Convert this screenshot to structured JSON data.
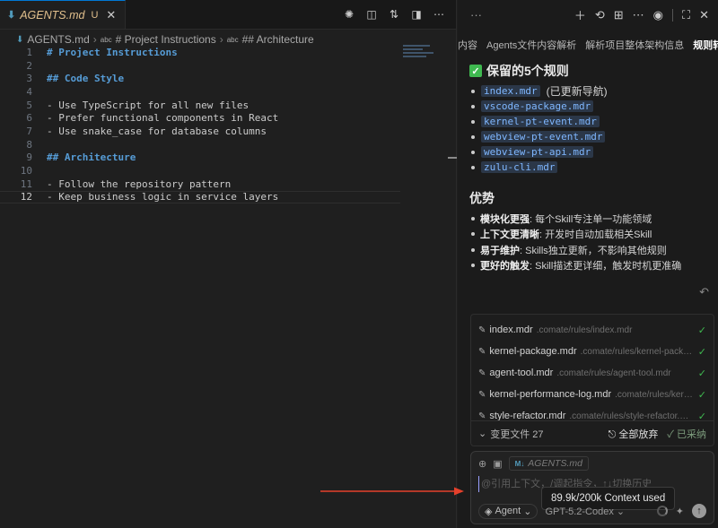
{
  "editor": {
    "tab": {
      "filename": "AGENTS.md",
      "status": "U"
    },
    "breadcrumb": [
      "AGENTS.md",
      "# Project Instructions",
      "## Architecture"
    ],
    "lines": [
      {
        "num": "1",
        "text": "# Project Instructions",
        "kind": "heading"
      },
      {
        "num": "2",
        "text": "",
        "kind": "text"
      },
      {
        "num": "3",
        "text": "## Code Style",
        "kind": "heading"
      },
      {
        "num": "4",
        "text": "",
        "kind": "text"
      },
      {
        "num": "5",
        "text": "- Use TypeScript for all new files",
        "kind": "text"
      },
      {
        "num": "6",
        "text": "- Prefer functional components in React",
        "kind": "text"
      },
      {
        "num": "7",
        "text": "- Use snake_case for database columns",
        "kind": "text"
      },
      {
        "num": "8",
        "text": "",
        "kind": "text"
      },
      {
        "num": "9",
        "text": "## Architecture",
        "kind": "heading"
      },
      {
        "num": "10",
        "text": "",
        "kind": "text"
      },
      {
        "num": "11",
        "text": "- Follow the repository pattern",
        "kind": "text"
      },
      {
        "num": "12",
        "text": "- Keep business logic in service layers",
        "kind": "text"
      }
    ]
  },
  "panel": {
    "top_dots": "···",
    "tabs": [
      {
        "label": "内容",
        "active": false
      },
      {
        "label": "Agents文件内容解析",
        "active": false
      },
      {
        "label": "解析项目整体架构信息",
        "active": false
      },
      {
        "label": "规则转换",
        "active": true
      }
    ],
    "rules_heading": "保留的5个规则",
    "rules": [
      {
        "code": "index.mdr",
        "note": "(已更新导航)"
      },
      {
        "code": "vscode-package.mdr",
        "note": ""
      },
      {
        "code": "kernel-pt-event.mdr",
        "note": ""
      },
      {
        "code": "webview-pt-event.mdr",
        "note": ""
      },
      {
        "code": "webview-pt-api.mdr",
        "note": ""
      },
      {
        "code": "zulu-cli.mdr",
        "note": ""
      }
    ],
    "advantages_heading": "优势",
    "advantages": [
      {
        "title": "模块化更强",
        "desc": ": 每个Skill专注单一功能领域"
      },
      {
        "title": "上下文更清晰",
        "desc": ": 开发时自动加载相关Skill"
      },
      {
        "title": "易于维护",
        "desc": ": Skills独立更新，不影响其他规则"
      },
      {
        "title": "更好的触发",
        "desc": ": Skill描述更详细，触发时机更准确"
      }
    ],
    "files": [
      {
        "name": "index.mdr",
        "path": ".comate/rules/index.mdr"
      },
      {
        "name": "kernel-package.mdr",
        "path": ".comate/rules/kernel-packag..."
      },
      {
        "name": "agent-tool.mdr",
        "path": ".comate/rules/agent-tool.mdr"
      },
      {
        "name": "kernel-performance-log.mdr",
        "path": ".comate/rules/kerne..."
      },
      {
        "name": "style-refactor.mdr",
        "path": ".comate/rules/style-refactor.mdr"
      }
    ],
    "files_footer": {
      "changed_label": "变更文件 27",
      "discard_all": "全部放弃",
      "adopted": "已采纳"
    },
    "input": {
      "context_chip": "AGENTS.md",
      "placeholder": "@引用上下文，/调起指令，↑↓切换历史",
      "tooltip": "89.9k/200k Context used",
      "mode": "Agent",
      "model": "GPT-5.2-Codex"
    }
  },
  "colors": {
    "accent": "#0078d4",
    "heading": "#569cd6",
    "success": "#3fb950",
    "modified": "#e2c08d",
    "annotation_arrow": "#e5402b"
  }
}
